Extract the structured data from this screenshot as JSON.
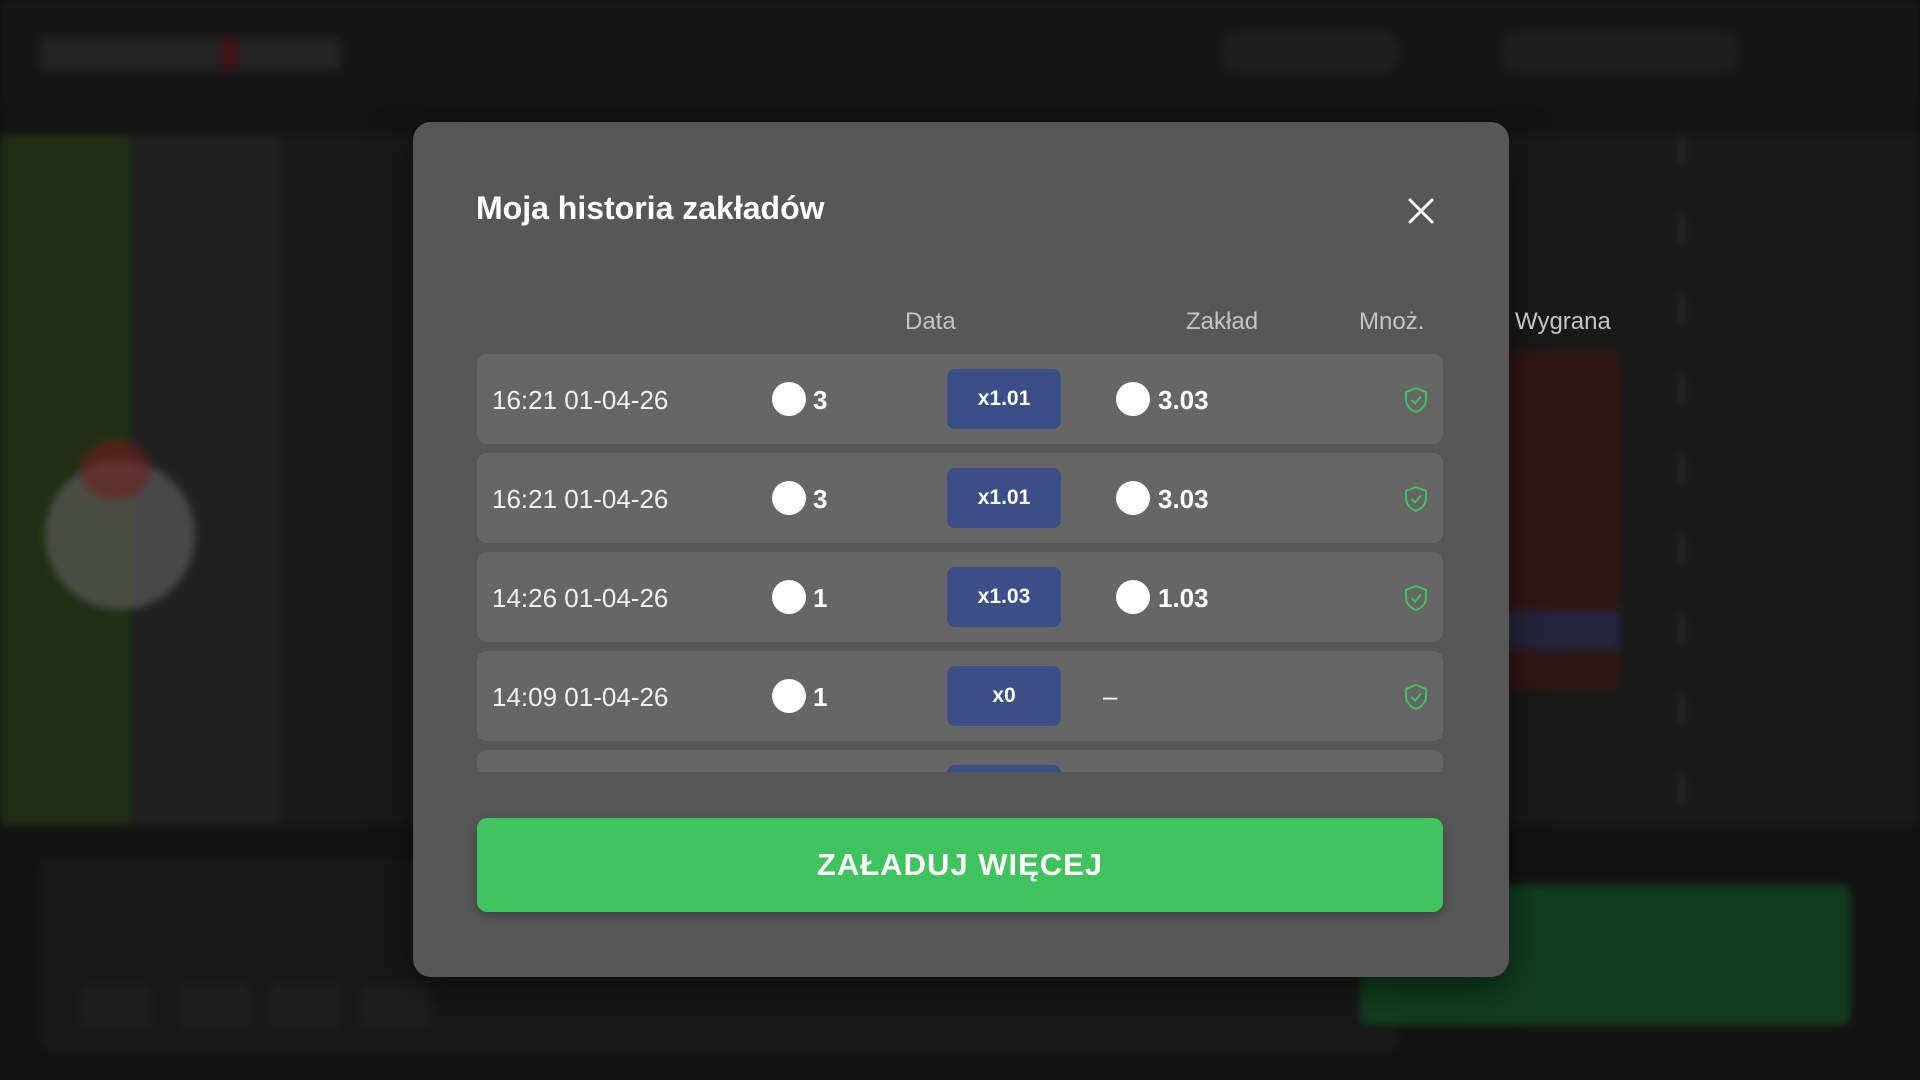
{
  "modal": {
    "title": "Moja historia zakładów",
    "close_icon": "close-icon",
    "columns": {
      "date": "Data",
      "bet": "Zakład",
      "multiplier": "Mnoż.",
      "win": "Wygrana"
    },
    "rows": [
      {
        "date": "16:21 01-04-26",
        "bet": "3",
        "multiplier": "x1.01",
        "win": "3.03",
        "win_coin": true
      },
      {
        "date": "16:21 01-04-26",
        "bet": "3",
        "multiplier": "x1.01",
        "win": "3.03",
        "win_coin": true
      },
      {
        "date": "14:26 01-04-26",
        "bet": "1",
        "multiplier": "x1.03",
        "win": "1.03",
        "win_coin": true
      },
      {
        "date": "14:09 01-04-26",
        "bet": "1",
        "multiplier": "x0",
        "win": "–",
        "win_coin": false
      }
    ],
    "row_icon": "shield-check-icon",
    "load_more_label": "ZAŁADUJ WIĘCEJ"
  },
  "colors": {
    "modal_bg": "#575757",
    "row_bg": "#666666",
    "multiplier_badge": "#3b4f86",
    "load_more_button": "#3fc35c",
    "shield_icon": "#3fc35c"
  }
}
